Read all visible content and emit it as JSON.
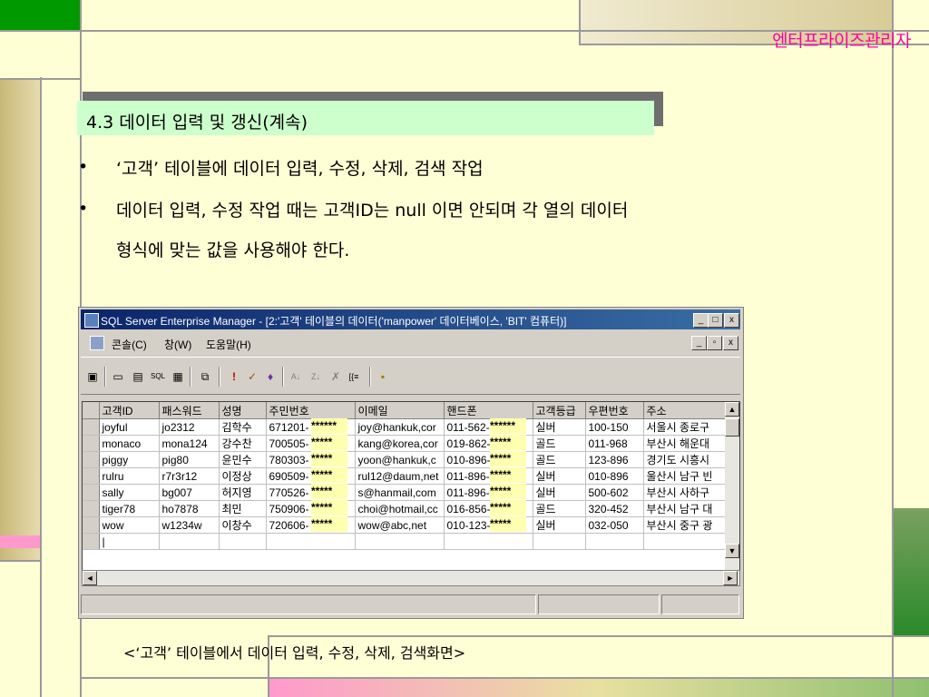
{
  "header": {
    "title": "엔터프라이즈관리자"
  },
  "slide": {
    "section_title": "4.3 데이터 입력 및 갱신(계속)",
    "bullets": [
      "‘고객’ 테이블에 데이터 입력, 수정, 삭제, 검색 작업",
      "데이터 입력, 수정 작업 때는 고객ID는 null 이면 안되며 각 열의 데이터",
      "형식에 맞는 값을 사용해야 한다."
    ],
    "bullet_marker": "•",
    "caption": "<‘고객’ 테이블에서 데이터 입력, 수정, 삭제, 검색화면>"
  },
  "window": {
    "title": "SQL Server Enterprise Manager - [2:'고객' 테이블의 데이터('manpower' 데이터베이스, 'BIT' 컴퓨터)]",
    "controls": {
      "minimize": "_",
      "maximize": "□",
      "close": "x",
      "restore": "▫"
    },
    "menu": [
      "콘솔(C)",
      "창(W)",
      "도움말(H)"
    ],
    "toolbar_icons": [
      "properties-icon",
      "show-diagram-icon",
      "show-grid-icon",
      "show-sql-icon",
      "show-results-icon",
      "new-window-icon",
      "run-icon",
      "verify-sql-icon",
      "sort-asc-icon",
      "sort-desc-icon",
      "remove-filter-icon",
      "group-by-icon",
      "add-table-icon"
    ],
    "toolbar_glyphs": [
      "▣",
      "▭",
      "▤",
      "SQL",
      "▦",
      "⧉",
      "!",
      "✓",
      "♦",
      "A↓",
      "Z↓",
      "✗",
      "[{≡",
      "▪"
    ],
    "grid": {
      "columns": [
        "고객ID",
        "패스워드",
        "성명",
        "주민번호",
        "이메일",
        "핸드폰",
        "고객등급",
        "우편번호",
        "주소"
      ],
      "rows": [
        [
          "joyful",
          "jo2312",
          "김학수",
          "671201-",
          "joy@hankuk,cor",
          "011-562-",
          "실버",
          "100-150",
          "서울시 종로구"
        ],
        [
          "monaco",
          "mona124",
          "강수찬",
          "700505-",
          "kang@korea,cor",
          "019-862-",
          "골드",
          "011-968",
          "부산시 해운대"
        ],
        [
          "piggy",
          "pig80",
          "윤민수",
          "780303-",
          "yoon@hankuk,c",
          "010-896-",
          "골드",
          "123-896",
          "경기도 시흥시"
        ],
        [
          "rulru",
          "r7r3r12",
          "이정상",
          "690509-",
          "rul12@daum,net",
          "011-896-",
          "실버",
          "010-896",
          "울산시 남구 빈"
        ],
        [
          "sally",
          "bg007",
          "허지영",
          "770526-",
          "s@hanmail,com",
          "011-896-",
          "실버",
          "500-602",
          "부산시 사하구"
        ],
        [
          "tiger78",
          "ho7878",
          "최민",
          "750906-",
          "choi@hotmail,cc",
          "016-856-",
          "골드",
          "320-452",
          "부산시 남구 대"
        ],
        [
          "wow",
          "w1234w",
          "이창수",
          "720606-",
          "wow@abc,net",
          "010-123-",
          "실버",
          "032-050",
          "부산시 중구 광"
        ]
      ],
      "masked_juminbeonho": [
        "******",
        "*****",
        "*****",
        "*****",
        "*****",
        "*****",
        "*****"
      ],
      "masked_phone": [
        "******",
        "*****",
        "*****",
        "*****",
        "*****",
        "*****",
        "*****"
      ],
      "new_row_cell": "|"
    },
    "scroll": {
      "up": "▲",
      "down": "▼",
      "left": "◄",
      "right": "►"
    }
  }
}
